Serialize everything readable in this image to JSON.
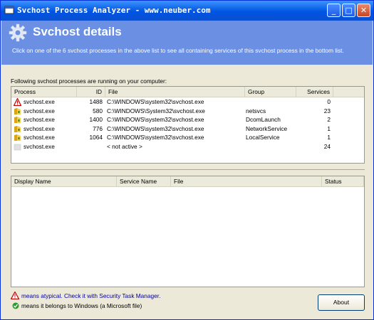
{
  "window": {
    "title": "Svchost Process Analyzer - www.neuber.com",
    "minimize": "_",
    "maximize": "□",
    "close": "✕"
  },
  "banner": {
    "title": "Svchost details",
    "description": "Click on one of the 6 svchost processes in the above list to see all containing services of this svchost process in the bottom list.",
    "color": "#6b8fe2"
  },
  "processes": {
    "caption": "Following svchost processes are running on your computer:",
    "columns": [
      "Process",
      "ID",
      "File",
      "Group",
      "Services"
    ],
    "rows": [
      {
        "icon": "warning-icon",
        "process": "svchost.exe",
        "id": "1488",
        "file": "C:\\WINDOWS\\system32\\svchost.exe",
        "group": "",
        "services": "0"
      },
      {
        "icon": "folder-icon",
        "process": "svchost.exe",
        "id": "580",
        "file": "C:\\WINDOWS\\System32\\svchost.exe",
        "group": "netsvcs",
        "services": "23"
      },
      {
        "icon": "folder-icon",
        "process": "svchost.exe",
        "id": "1400",
        "file": "C:\\WINDOWS\\system32\\svchost.exe",
        "group": "DcomLaunch",
        "services": "2"
      },
      {
        "icon": "folder-icon",
        "process": "svchost.exe",
        "id": "776",
        "file": "C:\\WINDOWS\\system32\\svchost.exe",
        "group": "NetworkService",
        "services": "1"
      },
      {
        "icon": "folder-icon",
        "process": "svchost.exe",
        "id": "1064",
        "file": "C:\\WINDOWS\\system32\\svchost.exe",
        "group": "LocalService",
        "services": "1"
      },
      {
        "icon": "inactive-icon",
        "process": "svchost.exe",
        "id": "",
        "file": "< not active >",
        "group": "",
        "services": "24"
      }
    ]
  },
  "services": {
    "columns": [
      "Display Name",
      "Service Name",
      "File",
      "Status"
    ]
  },
  "legend": {
    "atypical": "means atypical. Check it with Security Task Manager.",
    "windows": "means it belongs to Windows (a Microsoft file)"
  },
  "about_button": "About"
}
